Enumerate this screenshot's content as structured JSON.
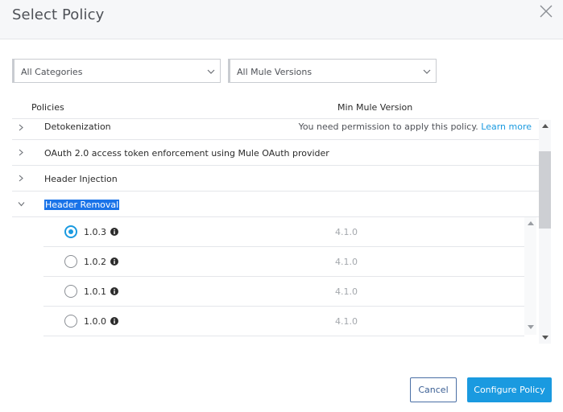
{
  "dialog": {
    "title": "Select Policy"
  },
  "filters": {
    "category": "All Categories",
    "mule_version": "All Mule Versions"
  },
  "table": {
    "headers": {
      "policies": "Policies",
      "min_mule_version": "Min Mule Version"
    },
    "policies": [
      {
        "name": "Detokenization",
        "expanded": false,
        "permission_text": "You need permission to apply this policy.",
        "learn_more": "Learn more"
      },
      {
        "name": "OAuth 2.0 access token enforcement using Mule OAuth provider",
        "expanded": false
      },
      {
        "name": "Header Injection",
        "expanded": false
      },
      {
        "name": "Header Removal",
        "expanded": true,
        "selected_text": true
      }
    ],
    "versions": [
      {
        "version": "1.0.3",
        "min_mule": "4.1.0",
        "checked": true
      },
      {
        "version": "1.0.2",
        "min_mule": "4.1.0",
        "checked": false
      },
      {
        "version": "1.0.1",
        "min_mule": "4.1.0",
        "checked": false
      },
      {
        "version": "1.0.0",
        "min_mule": "4.1.0",
        "checked": false
      }
    ]
  },
  "buttons": {
    "cancel": "Cancel",
    "configure": "Configure Policy"
  },
  "colors": {
    "accent": "#1a9ae0",
    "selection": "#1a73e8",
    "muted": "#a4a8ad"
  },
  "icons": {
    "close": "close-icon",
    "chevron": "chevron-down-icon",
    "expand": "chevron-right-icon",
    "info": "info-icon"
  }
}
